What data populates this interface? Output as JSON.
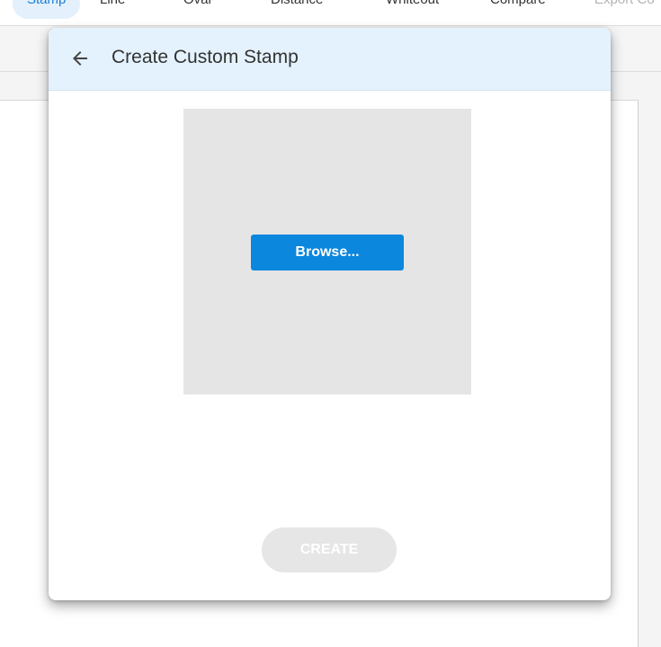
{
  "toolbar": {
    "tabs": [
      {
        "label": "Stamp",
        "state": "active"
      },
      {
        "label": "Line",
        "state": "normal"
      },
      {
        "label": "Oval",
        "state": "normal"
      },
      {
        "label": "Distance",
        "state": "normal"
      },
      {
        "label": "Whiteout",
        "state": "normal"
      },
      {
        "label": "Compare",
        "state": "normal"
      },
      {
        "label": "Export Co",
        "state": "disabled"
      }
    ]
  },
  "dialog": {
    "title": "Create Custom Stamp",
    "back_icon": "arrow-left-icon",
    "browse_label": "Browse...",
    "create_label": "CREATE",
    "create_enabled": false
  },
  "colors": {
    "accent": "#0b87de",
    "header_bg": "#e4f2fd",
    "drop_zone_bg": "#e5e5e5",
    "disabled_button_bg": "#e6e6e6"
  }
}
